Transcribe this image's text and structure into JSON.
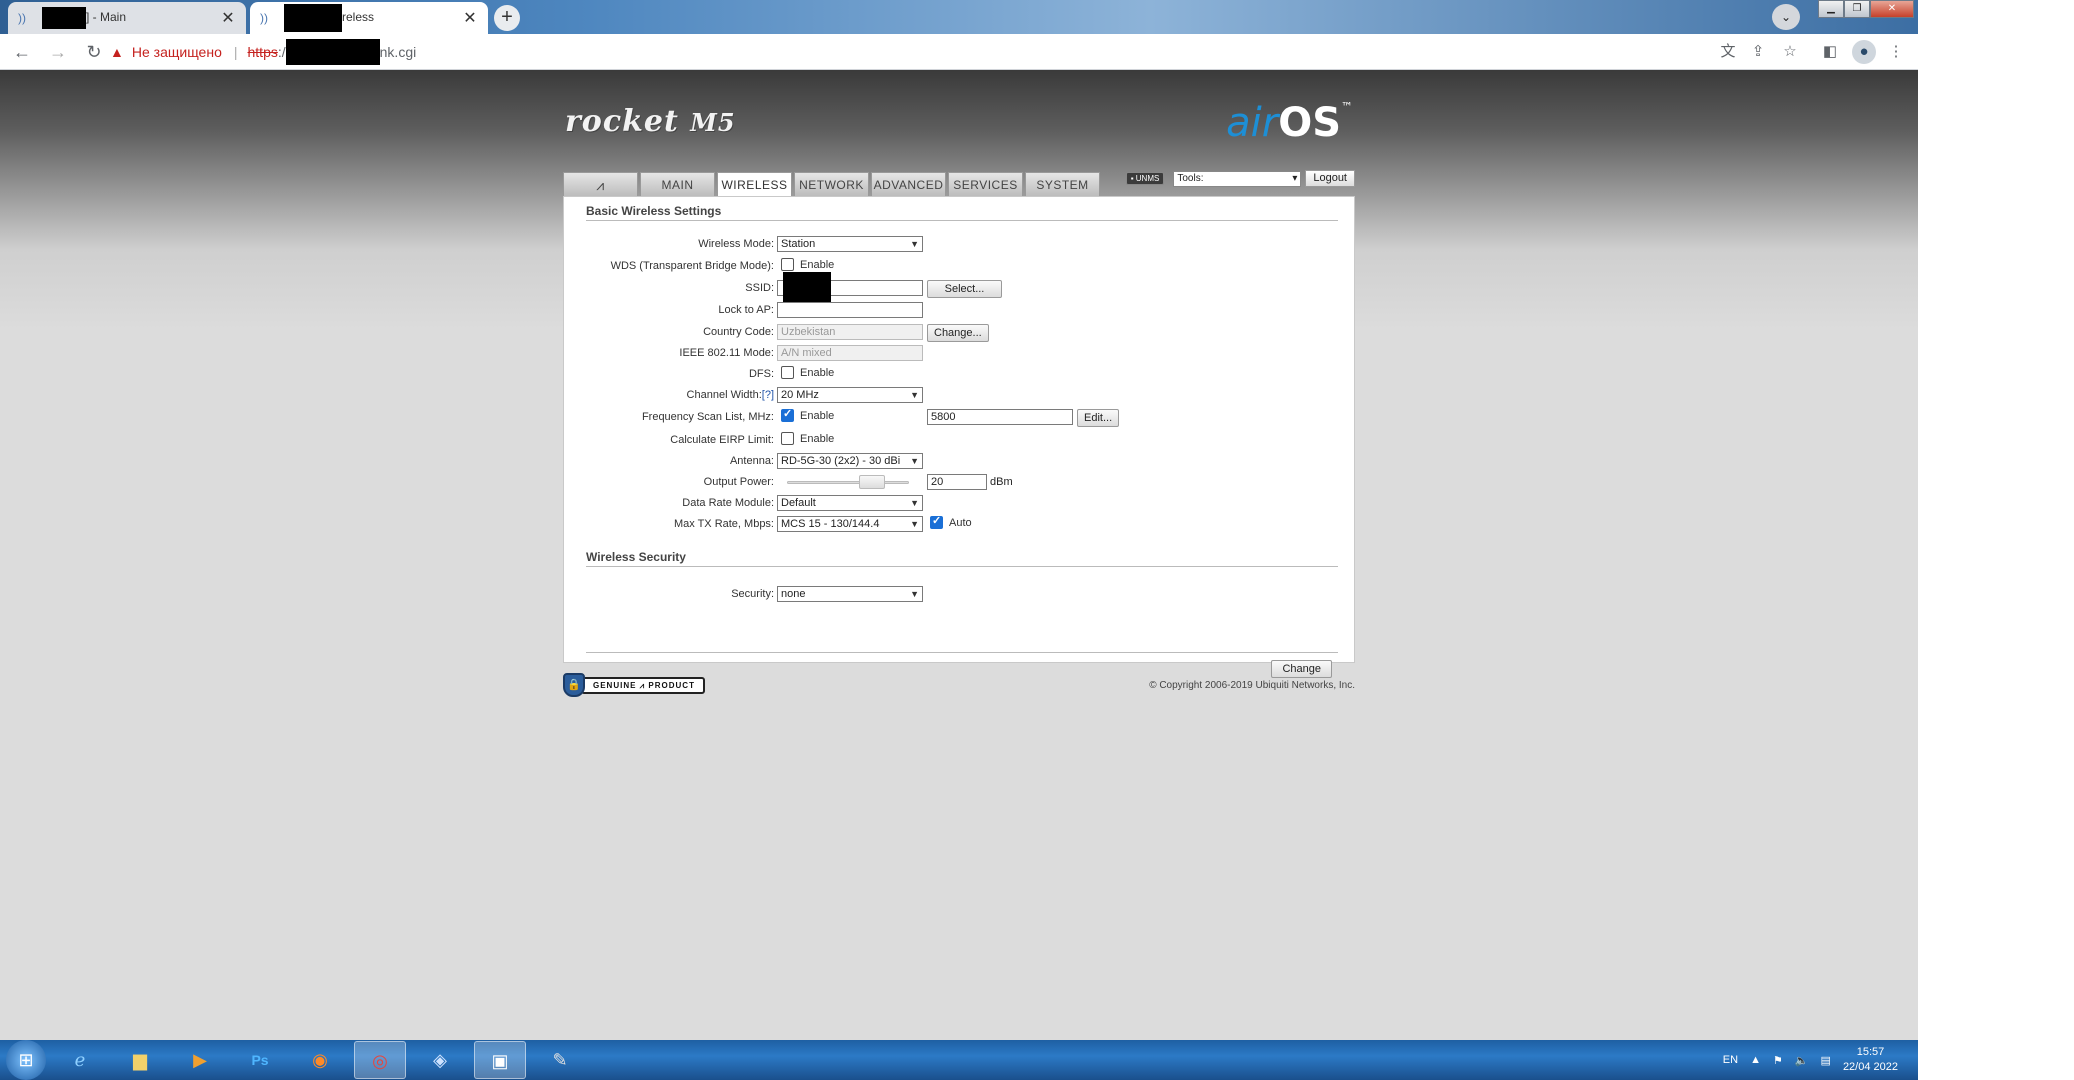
{
  "browser": {
    "tabs": [
      {
        "title_suffix": "] - Main",
        "active": false
      },
      {
        "title_suffix": "reless",
        "active": true
      }
    ],
    "new_tab_symbol": "+",
    "security_warning": "Не защищено",
    "url_scheme": "https",
    "url_rest": "nk.cgi"
  },
  "brand": {
    "product": "rocket",
    "model": "M5",
    "air": "air",
    "os": "OS",
    "tm": "™"
  },
  "nav": {
    "tabs": [
      "MAIN",
      "WIRELESS",
      "NETWORK",
      "ADVANCED",
      "SERVICES",
      "SYSTEM"
    ],
    "active": "WIRELESS",
    "unms_label": "UNMS",
    "tools_label": "Tools:",
    "logout_label": "Logout"
  },
  "basic": {
    "title": "Basic Wireless Settings",
    "wireless_mode": {
      "label": "Wireless Mode:",
      "value": "Station"
    },
    "wds": {
      "label": "WDS (Transparent Bridge Mode):",
      "option": "Enable",
      "checked": false
    },
    "ssid": {
      "label": "SSID:",
      "select_label": "Select..."
    },
    "lock_ap": {
      "label": "Lock to AP:"
    },
    "country": {
      "label": "Country Code:",
      "value": "Uzbekistan",
      "change_label": "Change..."
    },
    "ieee": {
      "label": "IEEE 802.11 Mode:",
      "value": "A/N mixed"
    },
    "dfs": {
      "label": "DFS:",
      "option": "Enable",
      "checked": false
    },
    "channel_width": {
      "label": "Channel Width:",
      "help": "[?]",
      "value": "20 MHz"
    },
    "freq_scan": {
      "label": "Frequency Scan List, MHz:",
      "option": "Enable",
      "checked": true,
      "value": "5800",
      "edit_label": "Edit..."
    },
    "eirp": {
      "label": "Calculate EIRP Limit:",
      "option": "Enable",
      "checked": false
    },
    "antenna": {
      "label": "Antenna:",
      "value": "RD-5G-30 (2x2) - 30 dBi"
    },
    "output_power": {
      "label": "Output Power:",
      "value": "20",
      "unit": "dBm",
      "level": 0.75
    },
    "data_rate": {
      "label": "Data Rate Module:",
      "value": "Default"
    },
    "max_tx": {
      "label": "Max TX Rate, Mbps:",
      "value": "MCS 15 - 130/144.4",
      "auto_label": "Auto",
      "auto_checked": true
    }
  },
  "security": {
    "title": "Wireless Security",
    "label": "Security:",
    "value": "none"
  },
  "change_label": "Change",
  "genuine": "GENUINE ⩘ PRODUCT",
  "copyright": "© Copyright 2006-2019 Ubiquiti Networks, Inc.",
  "taskbar": {
    "lang": "EN",
    "time": "15:57",
    "date": "22/04 2022"
  }
}
